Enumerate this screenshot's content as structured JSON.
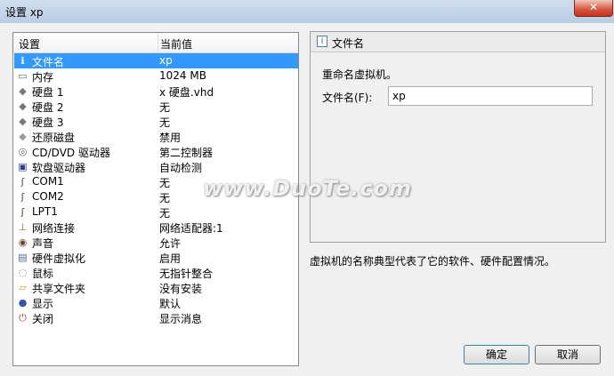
{
  "window": {
    "title": "设置 xp",
    "close_glyph": "✕"
  },
  "settings_list": {
    "headers": {
      "setting": "设置",
      "current_value": "当前值"
    },
    "rows": [
      {
        "icon": "info-icon",
        "glyph": "ℹ",
        "name": "文件名",
        "value": "xp"
      },
      {
        "icon": "memory-icon",
        "glyph": "▭",
        "name": "内存",
        "value": "1024 MB"
      },
      {
        "icon": "harddisk-icon",
        "glyph": "◆",
        "name": "硬盘 1",
        "value": "x 硬盘.vhd"
      },
      {
        "icon": "harddisk-icon",
        "glyph": "◆",
        "name": "硬盘 2",
        "value": "无"
      },
      {
        "icon": "harddisk-icon",
        "glyph": "◆",
        "name": "硬盘 3",
        "value": "无"
      },
      {
        "icon": "restore-disk-icon",
        "glyph": "◆",
        "name": "还原磁盘",
        "value": "禁用"
      },
      {
        "icon": "cd-icon",
        "glyph": "◎",
        "name": "CD/DVD 驱动器",
        "value": "第二控制器"
      },
      {
        "icon": "floppy-icon",
        "glyph": "▣",
        "name": "软盘驱动器",
        "value": "自动检测"
      },
      {
        "icon": "serial-port-icon",
        "glyph": "ʃ",
        "name": "COM1",
        "value": "无"
      },
      {
        "icon": "serial-port-icon",
        "glyph": "ʃ",
        "name": "COM2",
        "value": "无"
      },
      {
        "icon": "parallel-port-icon",
        "glyph": "ʃ",
        "name": "LPT1",
        "value": "无"
      },
      {
        "icon": "network-icon",
        "glyph": "⊥",
        "name": "网络连接",
        "value": "网络适配器:1"
      },
      {
        "icon": "sound-icon",
        "glyph": "◉",
        "name": "声音",
        "value": "允许"
      },
      {
        "icon": "hardware-virtualization-icon",
        "glyph": "▤",
        "name": "硬件虚拟化",
        "value": "启用"
      },
      {
        "icon": "mouse-icon",
        "glyph": "◌",
        "name": "鼠标",
        "value": "无指针整合"
      },
      {
        "icon": "shared-folder-icon",
        "glyph": "▱",
        "name": "共享文件夹",
        "value": "没有安装"
      },
      {
        "icon": "display-icon",
        "glyph": "●",
        "name": "显示",
        "value": "默认"
      },
      {
        "icon": "shutdown-icon",
        "glyph": "⏻",
        "name": "关闭",
        "value": "显示消息"
      }
    ],
    "selected_index": 0
  },
  "detail": {
    "header": "文件名",
    "header_icon": "info-icon",
    "header_glyph": "i",
    "instruction": "重命名虚拟机。",
    "field_label": "文件名(F):",
    "field_value": "xp",
    "description": "虚拟机的名称典型代表了它的软件、硬件配置情况。"
  },
  "buttons": {
    "ok": "确定",
    "cancel": "取消"
  },
  "watermark": "www.DuoTe.com",
  "colors": {
    "selection": "#3399ff",
    "titlebar": "#c4d6ea"
  }
}
